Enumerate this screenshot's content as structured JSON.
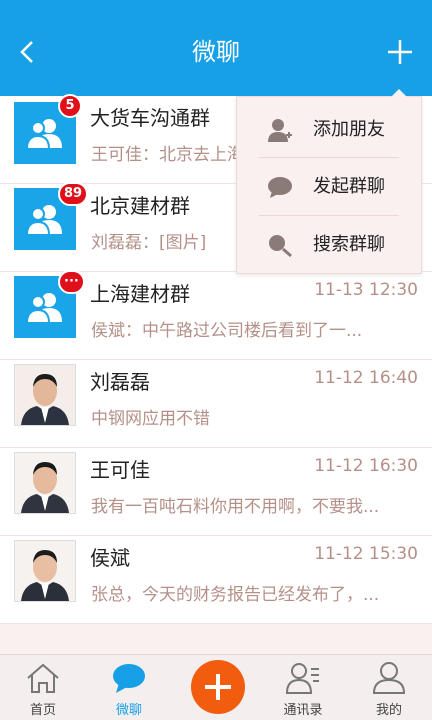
{
  "header": {
    "title": "微聊",
    "bg_color": "#17a0e6"
  },
  "menu": {
    "items": [
      {
        "label": "添加朋友",
        "icon": "add-friend-icon"
      },
      {
        "label": "发起群聊",
        "icon": "chat-bubble-icon"
      },
      {
        "label": "搜索群聊",
        "icon": "search-icon"
      }
    ]
  },
  "conversations": [
    {
      "name": "大货车沟通群",
      "preview": "王可佳：北京去上海",
      "time": "",
      "badge": "5",
      "type": "group"
    },
    {
      "name": "北京建材群",
      "preview": "刘磊磊：[图片]",
      "time": "",
      "badge": "89",
      "type": "group"
    },
    {
      "name": "上海建材群",
      "preview": "侯斌：中午路过公司楼后看到了一...",
      "time": "11-13  12:30",
      "badge": "···",
      "type": "group"
    },
    {
      "name": "刘磊磊",
      "preview": "中钢网应用不错",
      "time": "11-12  16:40",
      "badge": "",
      "type": "person"
    },
    {
      "name": "王可佳",
      "preview": "我有一百吨石料你用不用啊，不要我...",
      "time": "11-12  16:30",
      "badge": "",
      "type": "person"
    },
    {
      "name": "侯斌",
      "preview": "张总，今天的财务报告已经发布了，...",
      "time": "11-12  15:30",
      "badge": "",
      "type": "person"
    }
  ],
  "tabs": [
    {
      "label": "首页",
      "icon": "home-icon",
      "active": false
    },
    {
      "label": "微聊",
      "icon": "chat-icon",
      "active": true
    },
    {
      "label": "",
      "icon": "plus-icon",
      "active": false
    },
    {
      "label": "通讯录",
      "icon": "contacts-icon",
      "active": false
    },
    {
      "label": "我的",
      "icon": "profile-icon",
      "active": false
    }
  ],
  "colors": {
    "accent": "#17a0e6",
    "badge": "#e0101a",
    "fab": "#f25c0f",
    "muted_text": "#b49088"
  }
}
